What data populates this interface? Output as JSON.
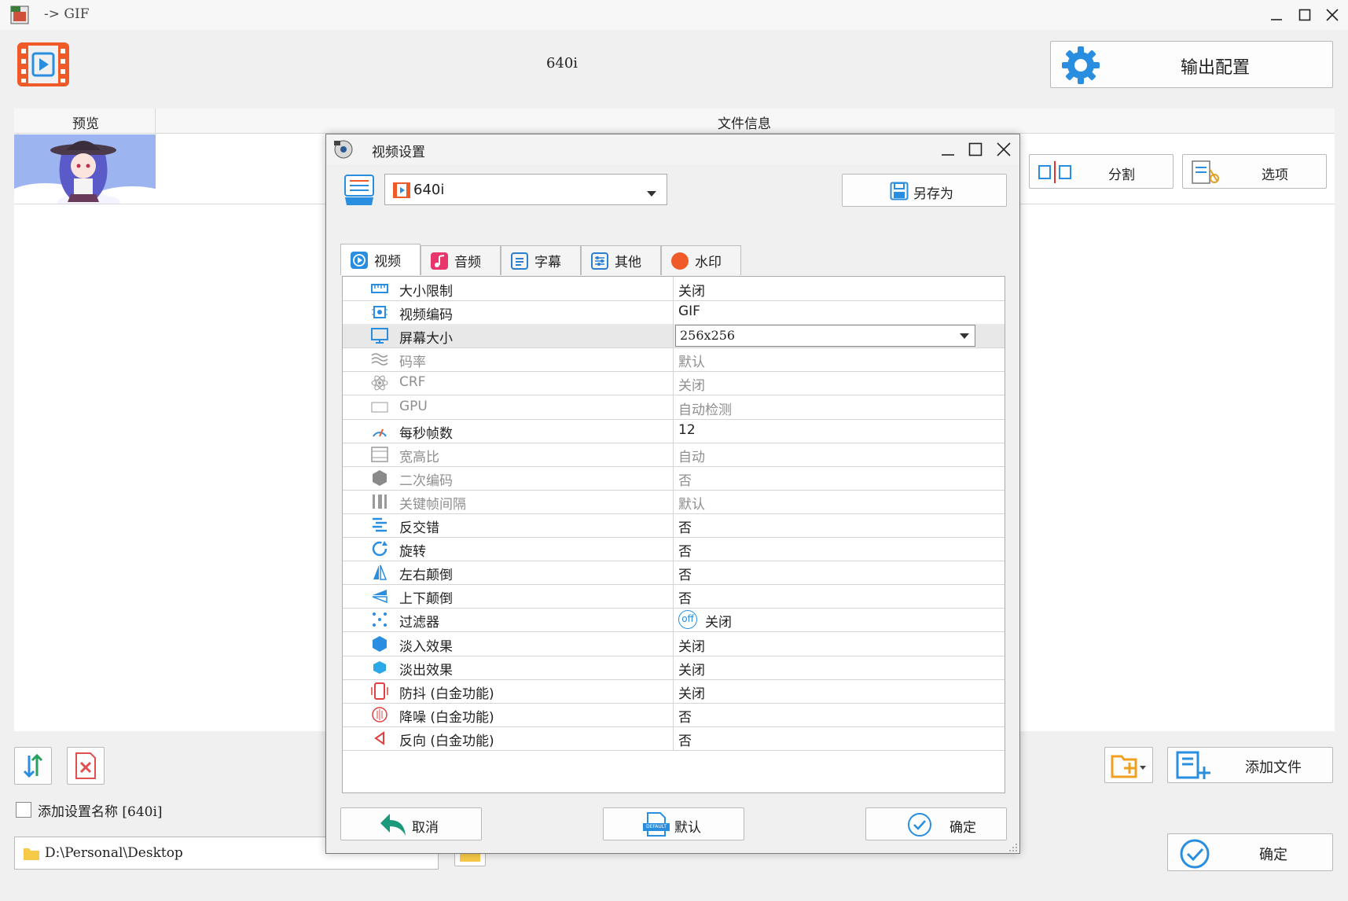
{
  "window": {
    "title": "-> GIF"
  },
  "header": {
    "profile_label": "640i",
    "output_config_label": "输出配置"
  },
  "columns": {
    "preview": "预览",
    "file_info": "文件信息"
  },
  "side_buttons": {
    "split": "分割",
    "options": "选项",
    "add_file": "添加文件",
    "confirm": "确定"
  },
  "bottom": {
    "add_setting_name_label": "添加设置名称 [640i]",
    "output_path": "D:\\Personal\\Desktop"
  },
  "dialog": {
    "title": "视频设置",
    "preset_value": "640i",
    "save_as_label": "另存为",
    "tabs": [
      {
        "label": "视频",
        "color": "#2a8ee0"
      },
      {
        "label": "音频",
        "color": "#e8356b"
      },
      {
        "label": "字幕",
        "color": "#2a7fd0"
      },
      {
        "label": "其他",
        "color": "#2a7fd0"
      },
      {
        "label": "水印",
        "color": "#f05a28"
      }
    ],
    "rows": [
      {
        "label": "大小限制",
        "value": "关闭",
        "disabled": false,
        "icon": "ruler-icon"
      },
      {
        "label": "视频编码",
        "value": "GIF",
        "disabled": false,
        "icon": "chip-icon"
      },
      {
        "label": "屏幕大小",
        "value": "256x256",
        "disabled": false,
        "icon": "screen-icon",
        "dropdown": true
      },
      {
        "label": "码率",
        "value": "默认",
        "disabled": true,
        "icon": "waves-icon"
      },
      {
        "label": "CRF",
        "value": "关闭",
        "disabled": true,
        "icon": "atom-icon"
      },
      {
        "label": "GPU",
        "value": "自动检测",
        "disabled": true,
        "icon": "gpu-icon"
      },
      {
        "label": "每秒帧数",
        "value": "12",
        "disabled": false,
        "icon": "speed-icon"
      },
      {
        "label": "宽高比",
        "value": "自动",
        "disabled": true,
        "icon": "aspect-icon"
      },
      {
        "label": "二次编码",
        "value": "否",
        "disabled": true,
        "icon": "two-pass-icon"
      },
      {
        "label": "关键帧间隔",
        "value": "默认",
        "disabled": true,
        "icon": "keyframe-icon"
      },
      {
        "label": "反交错",
        "value": "否",
        "disabled": false,
        "icon": "deinterlace-icon"
      },
      {
        "label": "旋转",
        "value": "否",
        "disabled": false,
        "icon": "rotate-icon"
      },
      {
        "label": "左右颠倒",
        "value": "否",
        "disabled": false,
        "icon": "flip-horizontal-icon"
      },
      {
        "label": "上下颠倒",
        "value": "否",
        "disabled": false,
        "icon": "flip-vertical-icon"
      },
      {
        "label": "过滤器",
        "value": "关闭",
        "disabled": false,
        "icon": "filter-icon",
        "off_badge": "off"
      },
      {
        "label": "淡入效果",
        "value": "关闭",
        "disabled": false,
        "icon": "fade-in-icon"
      },
      {
        "label": "淡出效果",
        "value": "关闭",
        "disabled": false,
        "icon": "fade-out-icon"
      },
      {
        "label": "防抖 (白金功能)",
        "value": "关闭",
        "disabled": false,
        "icon": "stabilize-icon"
      },
      {
        "label": "降噪 (白金功能)",
        "value": "否",
        "disabled": false,
        "icon": "denoise-icon"
      },
      {
        "label": "反向 (白金功能)",
        "value": "否",
        "disabled": false,
        "icon": "reverse-icon"
      }
    ],
    "cancel_label": "取消",
    "default_label": "默认",
    "ok_label": "确定",
    "default_icon_text": "DEFAULT"
  },
  "colors": {
    "accent_blue": "#2a8ee0",
    "orange": "#f05a28"
  }
}
